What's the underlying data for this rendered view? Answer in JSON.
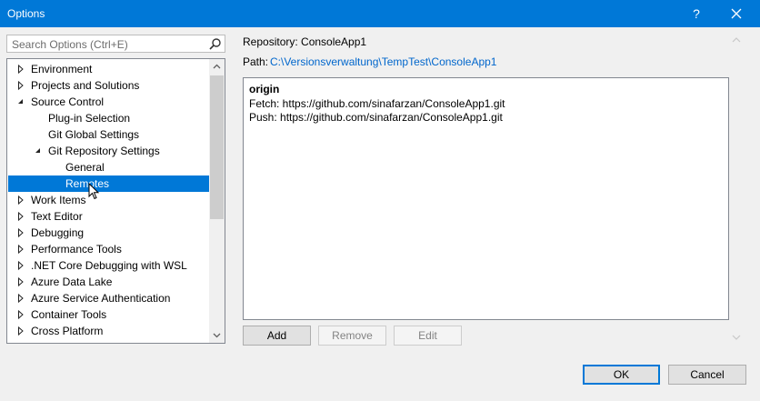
{
  "window": {
    "title": "Options",
    "help_label": "?"
  },
  "search": {
    "placeholder": "Search Options (Ctrl+E)"
  },
  "tree": {
    "items": [
      {
        "label": "Environment",
        "expander": "collapsed",
        "selected": false
      },
      {
        "label": "Projects and Solutions",
        "expander": "collapsed",
        "selected": false
      },
      {
        "label": "Source Control",
        "expander": "expanded",
        "selected": false
      },
      {
        "label": "Plug-in Selection",
        "expander": "none",
        "selected": false
      },
      {
        "label": "Git Global Settings",
        "expander": "none",
        "selected": false
      },
      {
        "label": "Git Repository Settings",
        "expander": "expanded",
        "selected": false
      },
      {
        "label": "General",
        "expander": "none",
        "selected": false
      },
      {
        "label": "Remotes",
        "expander": "none",
        "selected": true
      },
      {
        "label": "Work Items",
        "expander": "collapsed",
        "selected": false
      },
      {
        "label": "Text Editor",
        "expander": "collapsed",
        "selected": false
      },
      {
        "label": "Debugging",
        "expander": "collapsed",
        "selected": false
      },
      {
        "label": "Performance Tools",
        "expander": "collapsed",
        "selected": false
      },
      {
        "label": ".NET Core Debugging with WSL",
        "expander": "collapsed",
        "selected": false
      },
      {
        "label": "Azure Data Lake",
        "expander": "collapsed",
        "selected": false
      },
      {
        "label": "Azure Service Authentication",
        "expander": "collapsed",
        "selected": false
      },
      {
        "label": "Container Tools",
        "expander": "collapsed",
        "selected": false
      },
      {
        "label": "Cross Platform",
        "expander": "collapsed",
        "selected": false
      }
    ]
  },
  "main": {
    "repository_label": "Repository: ConsoleApp1",
    "path_label": "Path:",
    "path_value": "C:\\Versionsverwaltung\\TempTest\\ConsoleApp1",
    "remote": {
      "name": "origin",
      "fetch": "Fetch: https://github.com/sinafarzan/ConsoleApp1.git",
      "push": "Push: https://github.com/sinafarzan/ConsoleApp1.git"
    },
    "buttons": {
      "add": "Add",
      "remove": "Remove",
      "edit": "Edit"
    }
  },
  "footer": {
    "ok": "OK",
    "cancel": "Cancel"
  },
  "colors": {
    "accent": "#0078d7",
    "link": "#0066cc",
    "selection": "#0078d7"
  }
}
